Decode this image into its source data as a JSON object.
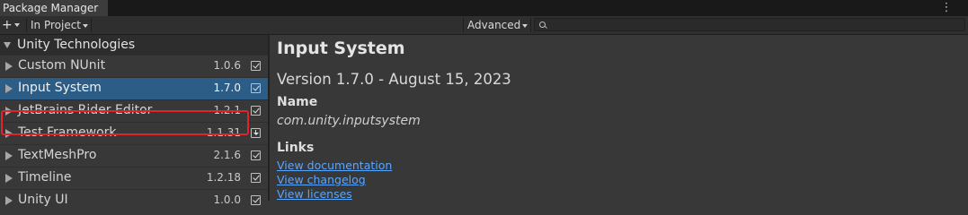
{
  "window": {
    "title": "Package Manager",
    "menu_icon": "vertical-ellipsis-icon"
  },
  "toolbar": {
    "add_label": "+",
    "scope_label": "In Project",
    "advanced_label": "Advanced",
    "search": {
      "value": "",
      "placeholder": ""
    }
  },
  "sidebar": {
    "group": "Unity Technologies",
    "packages": [
      {
        "name": "Custom NUnit",
        "version": "1.0.6",
        "status": "installed"
      },
      {
        "name": "Input System",
        "version": "1.7.0",
        "status": "installed",
        "selected": true
      },
      {
        "name": "JetBrains Rider Editor",
        "version": "1.2.1",
        "status": "installed"
      },
      {
        "name": "Test Framework",
        "version": "1.1.31",
        "status": "update-available"
      },
      {
        "name": "TextMeshPro",
        "version": "2.1.6",
        "status": "installed"
      },
      {
        "name": "Timeline",
        "version": "1.2.18",
        "status": "installed"
      },
      {
        "name": "Unity UI",
        "version": "1.0.0",
        "status": "installed"
      }
    ]
  },
  "details": {
    "title": "Input System",
    "version_line": "Version 1.7.0 - August 15, 2023",
    "name_heading": "Name",
    "package_id": "com.unity.inputsystem",
    "links_heading": "Links",
    "links": [
      "View documentation",
      "View changelog",
      "View licenses"
    ]
  },
  "colors": {
    "selection": "#2c5d87",
    "highlight_box": "#e0242b",
    "link": "#58a6ff"
  }
}
